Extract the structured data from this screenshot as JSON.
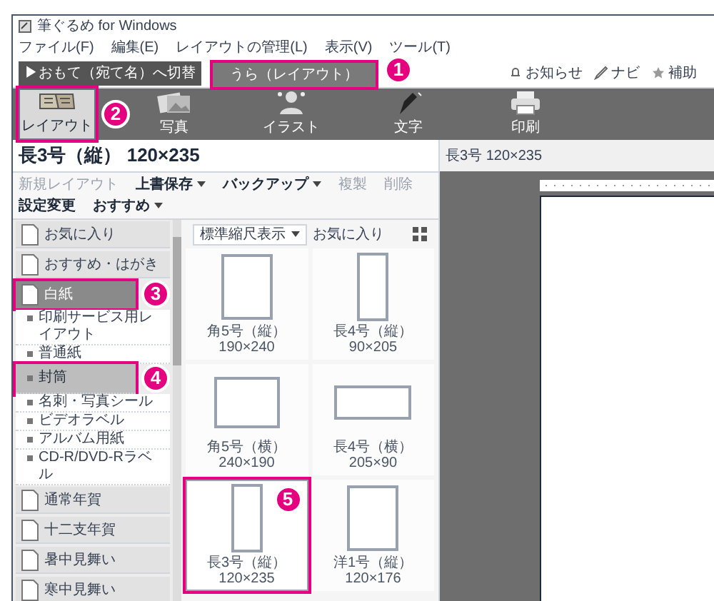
{
  "window": {
    "title": "筆ぐるめ for Windows"
  },
  "menu": [
    "ファイル(F)",
    "編集(E)",
    "レイアウトの管理(L)",
    "表示(V)",
    "ツール(T)"
  ],
  "side_switch": {
    "front_button": "▶おもて（宛て名）へ切替",
    "back_tab": {
      "label": "うら（レイアウト）",
      "selected": true,
      "callout": "1"
    }
  },
  "help_links": [
    "お知らせ",
    "ナビ",
    "補助"
  ],
  "ribbon": [
    {
      "label": "レイアウト",
      "selected": true,
      "callout": "2"
    },
    {
      "label": "写真",
      "selected": false
    },
    {
      "label": "イラスト",
      "selected": false
    },
    {
      "label": "文字",
      "selected": false
    },
    {
      "label": "印刷",
      "selected": false
    }
  ],
  "layout_title": "長3号（縦） 120×235",
  "toolbar": [
    {
      "label": "新規レイアウト",
      "disabled": true,
      "dropdown": false
    },
    {
      "label": "上書保存",
      "disabled": false,
      "dropdown": true
    },
    {
      "label": "バックアップ",
      "disabled": false,
      "dropdown": true
    },
    {
      "label": "複製",
      "disabled": true,
      "dropdown": false
    },
    {
      "label": "削除",
      "disabled": true,
      "dropdown": false
    },
    {
      "label": "設定変更",
      "disabled": false,
      "dropdown": false
    },
    {
      "label": "おすすめ",
      "disabled": false,
      "dropdown": true
    }
  ],
  "categories": [
    {
      "label": "お気に入り",
      "selected": false
    },
    {
      "label": "おすすめ・はがき",
      "selected": false
    },
    {
      "label": "白紙",
      "selected": true,
      "callout": "3",
      "children": [
        {
          "label": "印刷サービス用レイアウト",
          "selected": false
        },
        {
          "label": "普通紙",
          "selected": false
        },
        {
          "label": "封筒",
          "selected": true,
          "callout": "4"
        },
        {
          "label": "名刺・写真シール",
          "selected": false
        },
        {
          "label": "ビデオラベル",
          "selected": false
        },
        {
          "label": "アルバム用紙",
          "selected": false
        },
        {
          "label": "CD-R/DVD-Rラベル",
          "selected": false
        }
      ]
    },
    {
      "label": "通常年賀",
      "selected": false
    },
    {
      "label": "十二支年賀",
      "selected": false
    },
    {
      "label": "暑中見舞い",
      "selected": false
    },
    {
      "label": "寒中見舞い",
      "selected": false
    }
  ],
  "view": {
    "scale": "標準縮尺表示",
    "favorites": "お気に入り"
  },
  "templates": [
    {
      "label": "角5号（縦） 190×240",
      "kind": "portrait",
      "selected": false
    },
    {
      "label": "長4号（縦） 90×205",
      "kind": "narrow",
      "selected": false
    },
    {
      "label": "角5号（横） 240×190",
      "kind": "landscape",
      "selected": false
    },
    {
      "label": "長4号（横） 205×90",
      "kind": "wide",
      "selected": false
    },
    {
      "label": "長3号（縦） 120×235",
      "kind": "narrow",
      "selected": true,
      "callout": "5"
    },
    {
      "label": "洋1号（縦） 120×176",
      "kind": "portrait",
      "selected": false
    }
  ],
  "preview": {
    "title": "長3号 120×235"
  }
}
